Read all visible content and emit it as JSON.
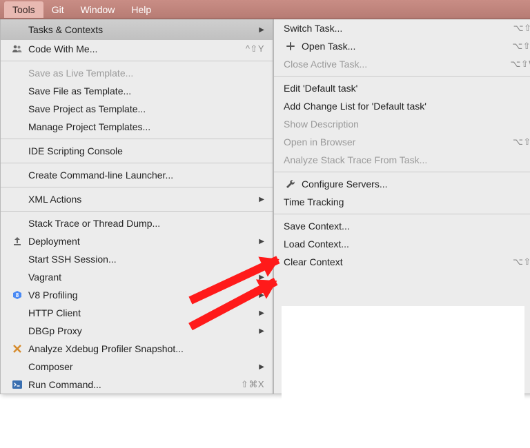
{
  "menubar": {
    "items": [
      "Tools",
      "Git",
      "Window",
      "Help"
    ],
    "activeIndex": 0
  },
  "leftMenu": {
    "sections": [
      [
        {
          "label": "Tasks & Contexts",
          "submenu": true,
          "highlight": true,
          "icon": ""
        },
        {
          "label": "Code With Me...",
          "icon": "people",
          "shortcut": "^⇧Y"
        }
      ],
      [
        {
          "label": "Save as Live Template...",
          "disabled": true
        },
        {
          "label": "Save File as Template..."
        },
        {
          "label": "Save Project as Template..."
        },
        {
          "label": "Manage Project Templates..."
        }
      ],
      [
        {
          "label": "IDE Scripting Console"
        }
      ],
      [
        {
          "label": "Create Command-line Launcher..."
        }
      ],
      [
        {
          "label": "XML Actions",
          "submenu": true
        }
      ],
      [
        {
          "label": "Stack Trace or Thread Dump..."
        },
        {
          "label": "Deployment",
          "icon": "upload",
          "submenu": true
        },
        {
          "label": "Start SSH Session..."
        },
        {
          "label": "Vagrant",
          "submenu": true
        },
        {
          "label": "V8 Profiling",
          "icon": "v8",
          "submenu": true
        },
        {
          "label": "HTTP Client",
          "submenu": true
        },
        {
          "label": "DBGp Proxy",
          "submenu": true
        },
        {
          "label": "Analyze Xdebug Profiler Snapshot...",
          "icon": "xdebug"
        },
        {
          "label": "Composer",
          "submenu": true
        },
        {
          "label": "Run Command...",
          "icon": "terminal",
          "shortcut": "⇧⌘X"
        }
      ]
    ]
  },
  "rightMenu": {
    "sections": [
      [
        {
          "label": "Switch Task...",
          "shortcut": "⌥⇧T"
        },
        {
          "label": "Open Task...",
          "icon": "plus",
          "shortcut": "⌥⇧N"
        },
        {
          "label": "Close Active Task...",
          "disabled": true,
          "shortcut": "⌥⇧W"
        }
      ],
      [
        {
          "label": "Edit 'Default task'"
        },
        {
          "label": "Add Change List for 'Default task'"
        },
        {
          "label": "Show Description",
          "disabled": true
        },
        {
          "label": "Open in Browser",
          "disabled": true,
          "shortcut": "⌥⇧B"
        },
        {
          "label": "Analyze Stack Trace From Task...",
          "disabled": true
        }
      ],
      [
        {
          "label": "Configure Servers...",
          "icon": "wrench"
        },
        {
          "label": "Time Tracking",
          "submenu": true
        }
      ],
      [
        {
          "label": "Save Context..."
        },
        {
          "label": "Load Context..."
        },
        {
          "label": "Clear Context",
          "shortcut": "⌥⇧X"
        }
      ]
    ]
  }
}
